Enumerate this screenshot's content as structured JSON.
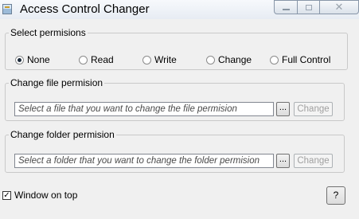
{
  "window": {
    "title": "Access Control Changer",
    "controls": {
      "minimize_icon": "minimize-icon",
      "maximize_icon": "maximize-icon",
      "close_glyph": "✕"
    }
  },
  "permissions": {
    "legend": "Select permisions",
    "options": [
      {
        "label": "None",
        "checked": true
      },
      {
        "label": "Read",
        "checked": false
      },
      {
        "label": "Write",
        "checked": false
      },
      {
        "label": "Change",
        "checked": false
      },
      {
        "label": "Full Control",
        "checked": false
      }
    ]
  },
  "file_group": {
    "legend": "Change file permision",
    "placeholder": "Select a file that you want to change the file permision",
    "browse_label": "...",
    "change_label": "Change"
  },
  "folder_group": {
    "legend": "Change folder permision",
    "placeholder": "Select a folder that you want to change the folder permision",
    "browse_label": "...",
    "change_label": "Change"
  },
  "footer": {
    "window_on_top_label": "Window on top",
    "window_on_top_checked": true,
    "checkmark": "✓",
    "help_label": "?"
  }
}
